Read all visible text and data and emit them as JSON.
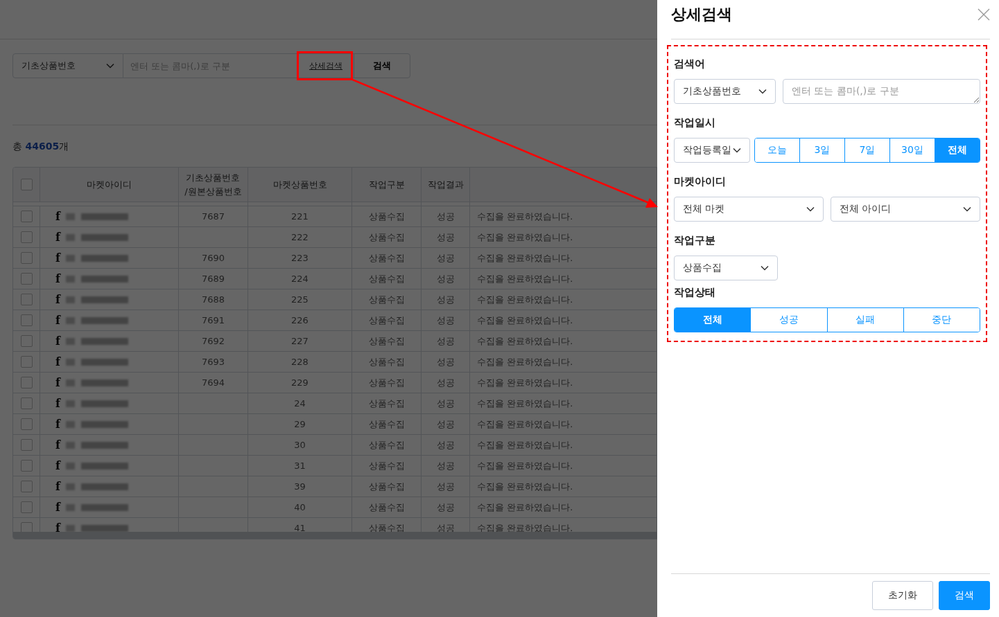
{
  "search_bar": {
    "select": "기초상품번호",
    "placeholder": "엔터 또는 콤마(,)로 구분",
    "detail_link": "상세검색",
    "button": "검색"
  },
  "total": {
    "prefix": "총 ",
    "count": "44605",
    "suffix": "개"
  },
  "table": {
    "header_checked": false,
    "columns": [
      "마켓아이디",
      "기초상품번호\n/원본상품번호",
      "마켓상품번호",
      "작업구분",
      "작업결과"
    ],
    "rows": [
      {
        "checked": false,
        "market_icon": "f",
        "base_no": "7687",
        "market_no": "221",
        "type": "상품수집",
        "result": "성공",
        "message": "수집을 완료하였습니다."
      },
      {
        "checked": false,
        "market_icon": "f",
        "base_no": "",
        "market_no": "222",
        "type": "상품수집",
        "result": "성공",
        "message": "수집을 완료하였습니다."
      },
      {
        "checked": false,
        "market_icon": "f",
        "base_no": "7690",
        "market_no": "223",
        "type": "상품수집",
        "result": "성공",
        "message": "수집을 완료하였습니다."
      },
      {
        "checked": false,
        "market_icon": "f",
        "base_no": "7689",
        "market_no": "224",
        "type": "상품수집",
        "result": "성공",
        "message": "수집을 완료하였습니다."
      },
      {
        "checked": false,
        "market_icon": "f",
        "base_no": "7688",
        "market_no": "225",
        "type": "상품수집",
        "result": "성공",
        "message": "수집을 완료하였습니다."
      },
      {
        "checked": false,
        "market_icon": "f",
        "base_no": "7691",
        "market_no": "226",
        "type": "상품수집",
        "result": "성공",
        "message": "수집을 완료하였습니다."
      },
      {
        "checked": false,
        "market_icon": "f",
        "base_no": "7692",
        "market_no": "227",
        "type": "상품수집",
        "result": "성공",
        "message": "수집을 완료하였습니다."
      },
      {
        "checked": false,
        "market_icon": "f",
        "base_no": "7693",
        "market_no": "228",
        "type": "상품수집",
        "result": "성공",
        "message": "수집을 완료하였습니다."
      },
      {
        "checked": false,
        "market_icon": "f",
        "base_no": "7694",
        "market_no": "229",
        "type": "상품수집",
        "result": "성공",
        "message": "수집을 완료하였습니다."
      },
      {
        "checked": false,
        "market_icon": "f",
        "base_no": "",
        "market_no": "24",
        "type": "상품수집",
        "result": "성공",
        "message": "수집을 완료하였습니다."
      },
      {
        "checked": false,
        "market_icon": "f",
        "base_no": "",
        "market_no": "29",
        "type": "상품수집",
        "result": "성공",
        "message": "수집을 완료하였습니다."
      },
      {
        "checked": false,
        "market_icon": "f",
        "base_no": "",
        "market_no": "30",
        "type": "상품수집",
        "result": "성공",
        "message": "수집을 완료하였습니다."
      },
      {
        "checked": false,
        "market_icon": "f",
        "base_no": "",
        "market_no": "31",
        "type": "상품수집",
        "result": "성공",
        "message": "수집을 완료하였습니다."
      },
      {
        "checked": false,
        "market_icon": "f",
        "base_no": "",
        "market_no": "39",
        "type": "상품수집",
        "result": "성공",
        "message": "수집을 완료하였습니다."
      },
      {
        "checked": false,
        "market_icon": "f",
        "base_no": "",
        "market_no": "40",
        "type": "상품수집",
        "result": "성공",
        "message": "수집을 완료하였습니다."
      },
      {
        "checked": false,
        "market_icon": "f",
        "base_no": "",
        "market_no": "41",
        "type": "상품수집",
        "result": "성공",
        "message": "수집을 완료하였습니다."
      }
    ]
  },
  "drawer": {
    "title": "상세검색",
    "sections": [
      {
        "kind": "keyword",
        "label": "검색어",
        "select": "기초상품번호",
        "placeholder": "엔터 또는 콤마(,)로 구분"
      },
      {
        "kind": "period",
        "label": "작업일시",
        "select": "작업등록일",
        "options": [
          {
            "label": "오늘",
            "selected": false
          },
          {
            "label": "3일",
            "selected": false
          },
          {
            "label": "7일",
            "selected": false
          },
          {
            "label": "30일",
            "selected": false
          },
          {
            "label": "전체",
            "selected": true
          }
        ]
      },
      {
        "kind": "two_selects",
        "label": "마켓아이디",
        "selects": [
          "전체 마켓",
          "전체 아이디"
        ]
      },
      {
        "kind": "select",
        "label": "작업구분",
        "select": "상품수집"
      },
      {
        "kind": "segments",
        "label": "작업상태",
        "options": [
          {
            "label": "전체",
            "selected": true
          },
          {
            "label": "성공",
            "selected": false
          },
          {
            "label": "실패",
            "selected": false
          },
          {
            "label": "중단",
            "selected": false
          }
        ]
      }
    ],
    "buttons": [
      {
        "label": "초기화",
        "kind": "secondary"
      },
      {
        "label": "검색",
        "kind": "primary"
      }
    ]
  }
}
